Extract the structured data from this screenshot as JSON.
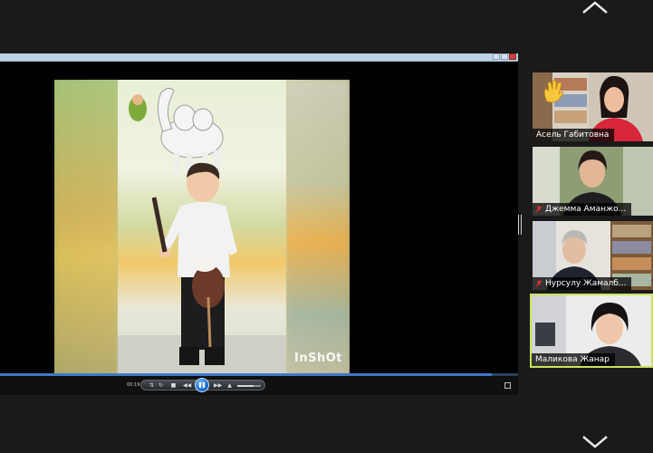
{
  "shared_screen": {
    "player": {
      "elapsed_time": "00:19",
      "progress_fraction": 0.95,
      "volume_fraction": 0.7
    },
    "video_watermark": "InShOt"
  },
  "participants": [
    {
      "name": "Асель Габитовна",
      "muted": false,
      "reaction": "raised-hand",
      "active": false
    },
    {
      "name": "Джемма Аманжо...",
      "muted": true,
      "active": false
    },
    {
      "name": "Нурсулу Жамалб...",
      "muted": true,
      "active": false
    },
    {
      "name": "Маликова Жанар",
      "muted": false,
      "active": true
    }
  ],
  "colors": {
    "background": "#1a1a1a",
    "active_speaker_border": "#c6e35a",
    "muted_mic": "#e0312b",
    "seek_fill": "#3f79c8"
  }
}
